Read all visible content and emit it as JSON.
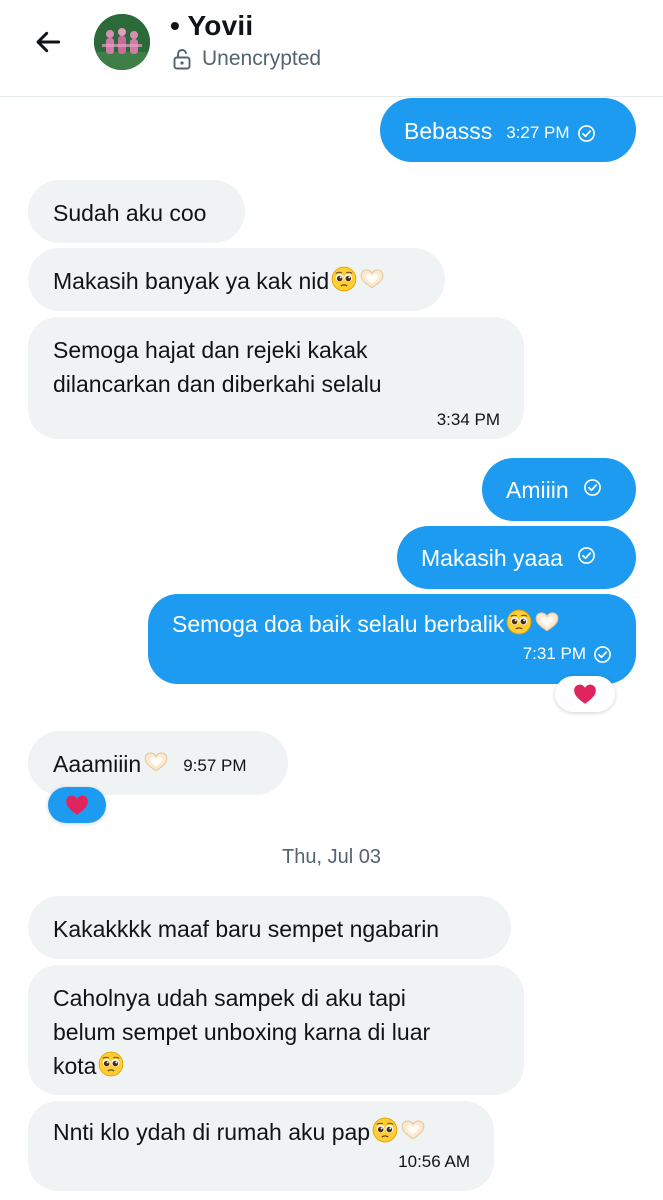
{
  "header": {
    "contact_name": "• Yovii",
    "encryption_status": "Unencrypted"
  },
  "messages": [
    {
      "id": "m1",
      "text": "Bebasss",
      "time": "3:27 PM"
    },
    {
      "id": "m2",
      "text": "Sudah aku coo"
    },
    {
      "id": "m3",
      "text": "Makasih banyak ya kak nid"
    },
    {
      "id": "m4",
      "line1": "Semoga hajat dan rejeki kakak",
      "line2": "dilancarkan dan diberkahi selalu",
      "time": "3:34 PM"
    },
    {
      "id": "m5",
      "text": "Amiiin"
    },
    {
      "id": "m6",
      "text": "Makasih yaaa"
    },
    {
      "id": "m7",
      "text": "Semoga doa baik selalu berbalik",
      "time": "7:31 PM"
    },
    {
      "id": "m8",
      "text": "Aaamiiin",
      "time": "9:57 PM"
    },
    {
      "id": "m9",
      "text": "Kakakkkk maaf baru sempet ngabarin"
    },
    {
      "id": "m10",
      "line1": "Caholnya udah sampek di aku tapi",
      "line2": "belum sempet unboxing karna di luar",
      "line3": "kota"
    },
    {
      "id": "m11",
      "text": "Nnti klo ydah di rumah aku pap",
      "time": "10:56 AM"
    }
  ],
  "date_separator": "Thu, Jul 03",
  "reactions": {
    "m7": "red-heart",
    "m8": "red-heart"
  },
  "colors": {
    "outgoing_bubble": "#1d9bf0",
    "incoming_bubble": "#eff3f4",
    "heart": "#e0245e",
    "avatar_bg": "#2c6a3a"
  },
  "icons": {
    "back": "arrow-left-icon",
    "lock": "unlocked-padlock-icon",
    "read": "check-circle-icon",
    "pleading_face": "pleading-face-emoji",
    "heart_hands": "heart-hands-emoji"
  }
}
